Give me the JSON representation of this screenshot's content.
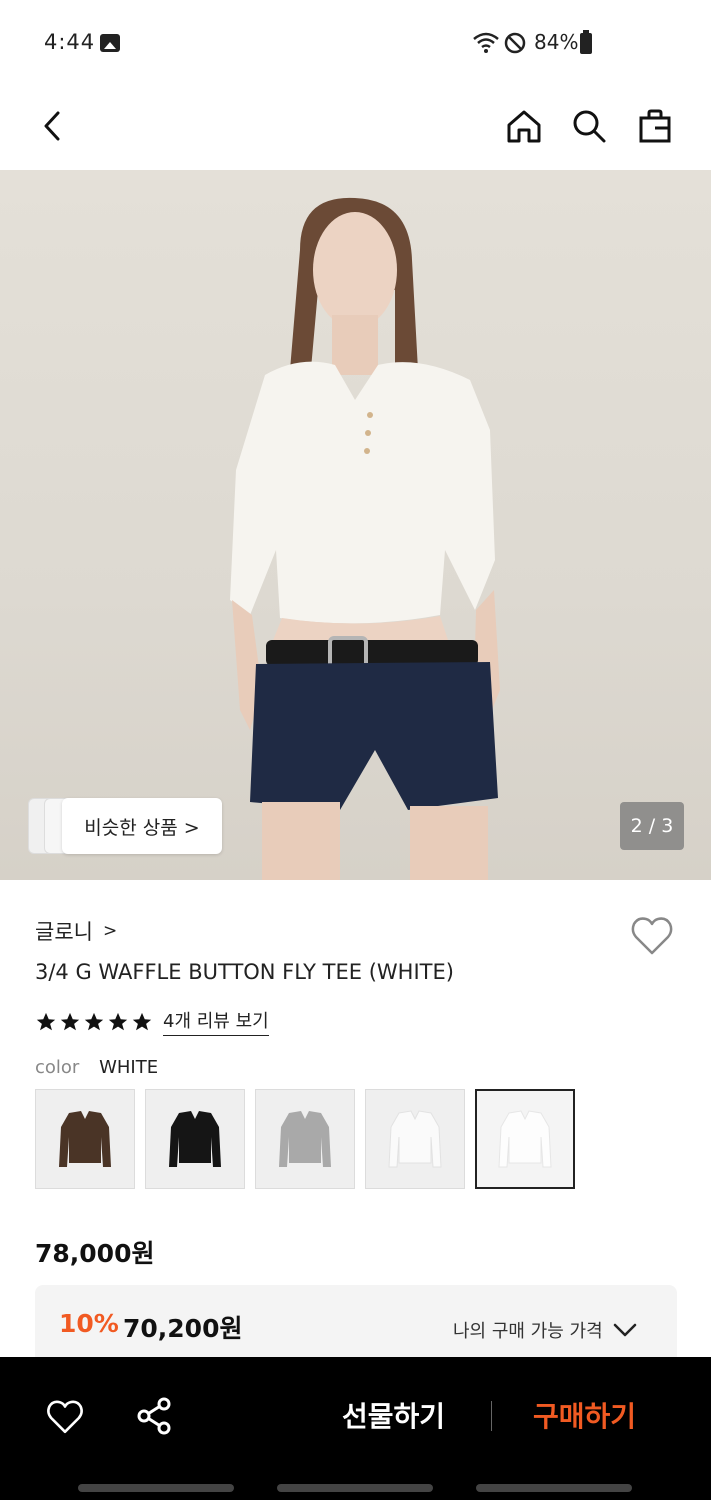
{
  "status": {
    "time": "4:44",
    "battery_pct": "84%",
    "battery_level": 0.84
  },
  "header": {
    "back": "back",
    "home": "home",
    "search": "search",
    "bag": "shopping-bag"
  },
  "hero": {
    "similar_label": "비슷한 상품 >",
    "pager": "2 / 3"
  },
  "product": {
    "brand": "글로니",
    "brand_chevron": ">",
    "title": "3/4 G WAFFLE BUTTON FLY TEE (WHITE)",
    "rating_stars": 5,
    "review_link": "4개 리뷰 보기",
    "color_label": "color",
    "color_value": "WHITE",
    "swatches": [
      {
        "name": "brown",
        "color": "#4a3426"
      },
      {
        "name": "black",
        "color": "#151515"
      },
      {
        "name": "gray",
        "color": "#a9a9a9"
      },
      {
        "name": "white-hooded",
        "color": "#f7f7f7"
      },
      {
        "name": "white",
        "color": "#fbfbfb",
        "selected": true
      }
    ],
    "price": "78,000원",
    "discount_pct": "10%",
    "discount_price": "70,200원",
    "my_price_label": "나의 구매 가능 가격"
  },
  "bottom_bar": {
    "gift_label": "선물하기",
    "buy_label": "구매하기"
  },
  "colors": {
    "accent": "#f15a22",
    "bar": "#000000"
  }
}
